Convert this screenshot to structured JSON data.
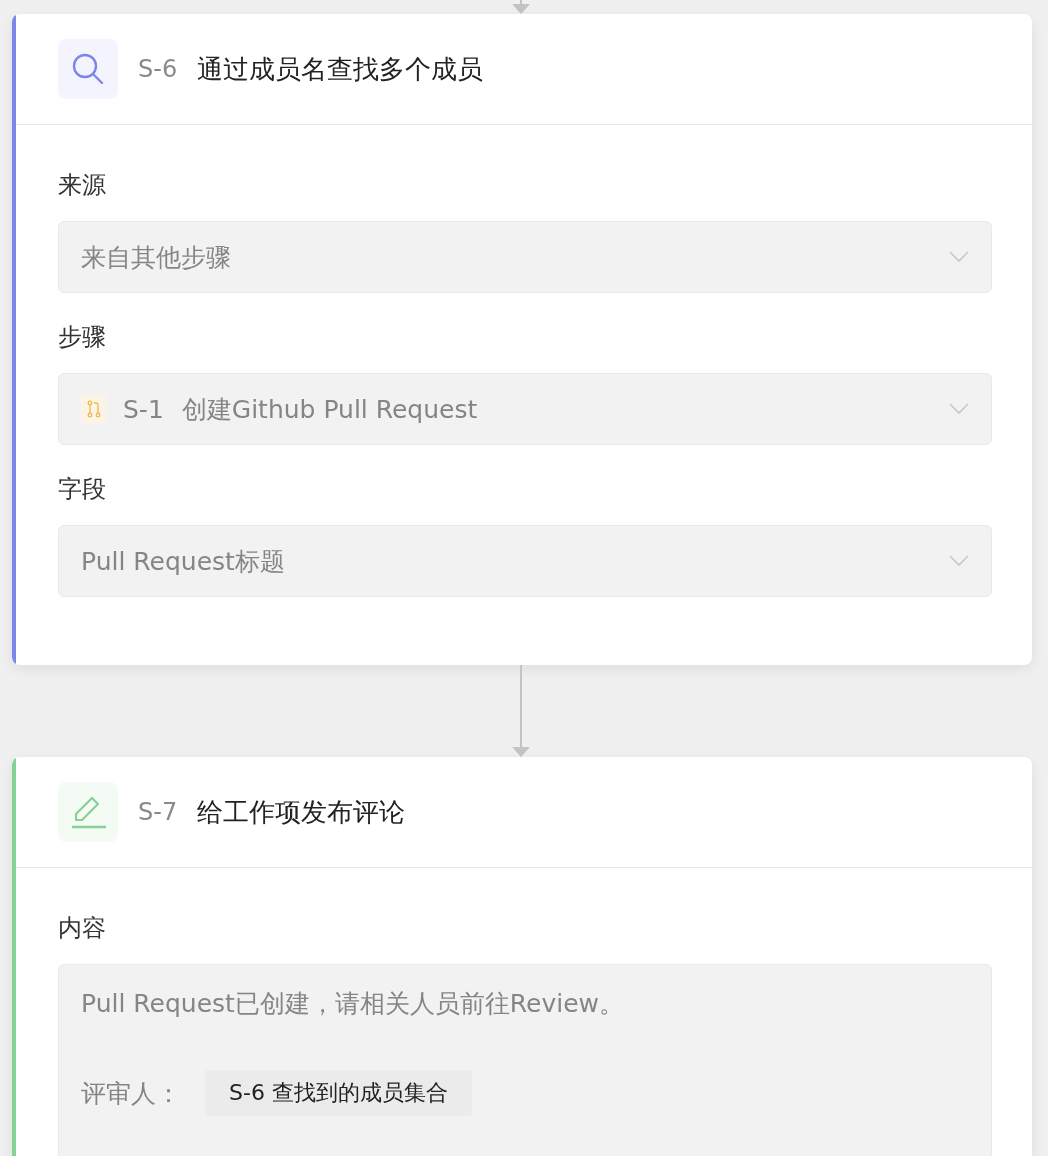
{
  "steps": [
    {
      "id": "S-6",
      "title": "通过成员名查找多个成员",
      "kind": "search",
      "color": "#7c85e8",
      "fields": [
        {
          "label": "来源",
          "kind": "select",
          "value": "来自其他步骤"
        },
        {
          "label": "步骤",
          "kind": "select",
          "step_ref": "S-1",
          "value": "创建Github Pull Request"
        },
        {
          "label": "字段",
          "kind": "select",
          "value": "Pull Request标题"
        }
      ]
    },
    {
      "id": "S-7",
      "title": "给工作项发布评论",
      "kind": "edit",
      "color": "#85d196",
      "fields": [
        {
          "label": "内容",
          "kind": "content",
          "text": "Pull Request已创建，请相关人员前往Review。",
          "reviewer_label": "评审人：",
          "reviewer_token": "S-6 查找到的成员集合"
        }
      ]
    }
  ]
}
